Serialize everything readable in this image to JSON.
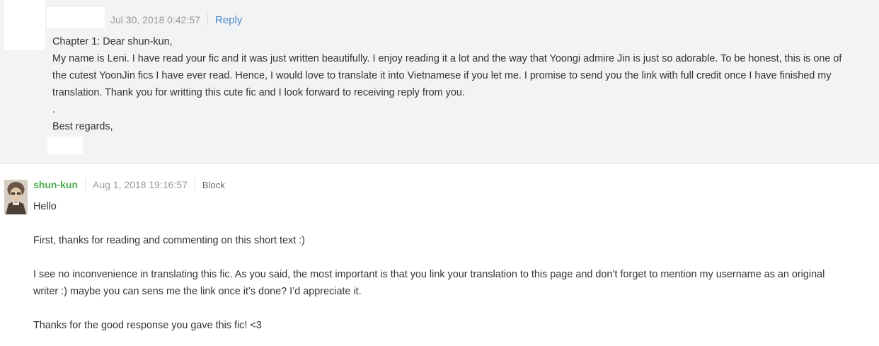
{
  "first_comment": {
    "timestamp": "Jul 30, 2018 0:42:57",
    "reply_label": "Reply",
    "lines": [
      "Chapter 1: Dear shun-kun,",
      "My name is Leni. I have read your fic and it was just written beautifully. I enjoy reading it a lot and the way that Yoongi admire Jin is just so adorable. To be honest, this is one of",
      "the cutest YoonJin fics I have ever read. Hence, I would love to translate it into Vietnamese if you let me. I promise to send you the link with full credit once I have finished my",
      "translation. Thank you for writting this cute fic and I look forward to receiving reply from you.",
      ".",
      "Best regards,"
    ]
  },
  "second_comment": {
    "username": "shun-kun",
    "timestamp": "Aug 1, 2018 19:16:57",
    "block_label": "Block",
    "lines": [
      "Hello",
      "",
      "First, thanks for reading and commenting on this short text :)",
      "",
      "I see no inconvenience in translating this fic. As you said, the most important is that you link your translation to this page and don’t forget to mention my username as an original",
      "writer :) maybe you can sens me the link once it’s done? I’d appreciate it.",
      "",
      "Thanks for the good response you gave this fic! <3"
    ]
  }
}
